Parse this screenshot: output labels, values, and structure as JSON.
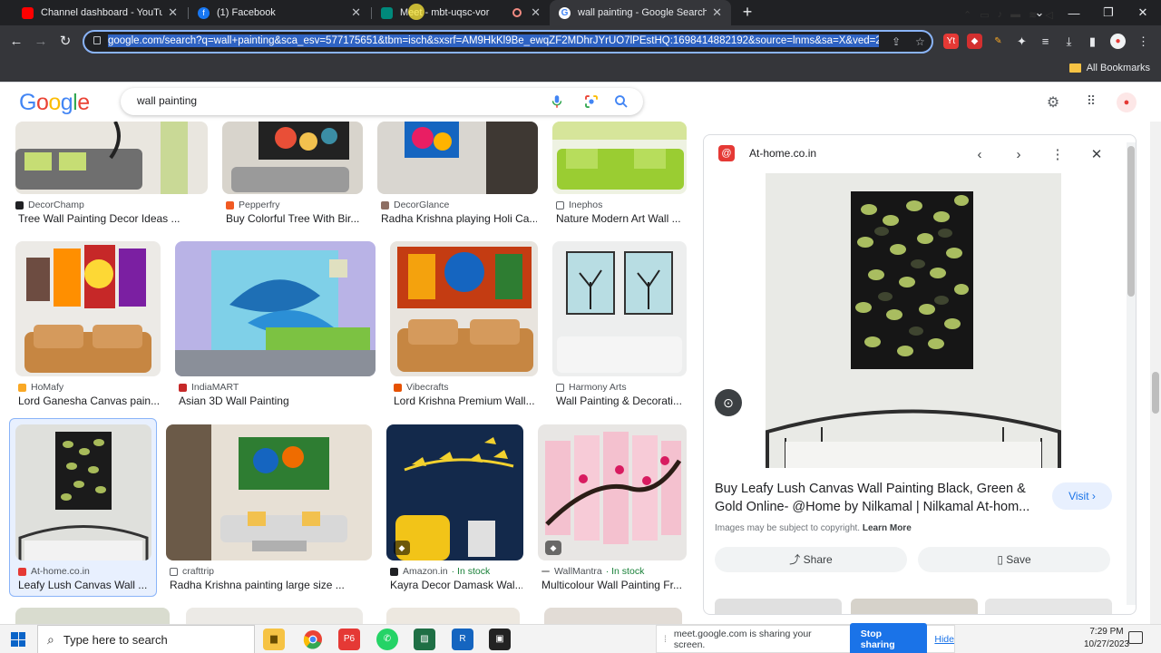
{
  "browser": {
    "tabs": [
      {
        "title": "Channel dashboard - YouTube S",
        "favicon_color": "#ff0000",
        "active": false
      },
      {
        "title": "(1) Facebook",
        "favicon_color": "#1877f2",
        "active": false
      },
      {
        "title": "Meet - mbt-uqsc-vor",
        "favicon_color": "#00897b",
        "active": false
      },
      {
        "title": "wall painting - Google Search",
        "favicon_color": "#ffffff",
        "active": true
      }
    ],
    "url": "google.com/search?q=wall+painting&sca_esv=577175651&tbm=isch&sxsrf=AM9HkKl9Be_ewqZF2MDhrJYrUO7lPEstHQ:1698414882192&source=lnms&sa=X&ved=2",
    "bookmarks_folder": "All Bookmarks"
  },
  "google": {
    "logo_letters": [
      {
        "ch": "G",
        "color": "#4285f4"
      },
      {
        "ch": "o",
        "color": "#ea4335"
      },
      {
        "ch": "o",
        "color": "#fbbc05"
      },
      {
        "ch": "g",
        "color": "#4285f4"
      },
      {
        "ch": "l",
        "color": "#34a853"
      },
      {
        "ch": "e",
        "color": "#ea4335"
      }
    ],
    "query": "wall painting"
  },
  "results": [
    {
      "source": "DecorChamp",
      "title": "Tree Wall Painting Decor Ideas ...",
      "fav": "#202124",
      "stock": ""
    },
    {
      "source": "Pepperfry",
      "title": "Buy Colorful Tree With Bir...",
      "fav": "#f15a22",
      "stock": ""
    },
    {
      "source": "DecorGlance",
      "title": "Radha Krishna playing Holi Ca...",
      "fav": "#8d6e63",
      "stock": ""
    },
    {
      "source": "Inephos",
      "title": "Nature Modern Art Wall ...",
      "fav": "#5f6368",
      "stock": ""
    },
    {
      "source": "HoMafy",
      "title": "Lord Ganesha Canvas pain...",
      "fav": "#f9a825",
      "stock": ""
    },
    {
      "source": "IndiaMART",
      "title": "Asian 3D Wall Painting",
      "fav": "#c62828",
      "stock": ""
    },
    {
      "source": "Vibecrafts",
      "title": "Lord Krishna Premium Wall...",
      "fav": "#e65100",
      "stock": ""
    },
    {
      "source": "Harmony Arts",
      "title": "Wall Painting & Decorati...",
      "fav": "#5f6368",
      "stock": ""
    },
    {
      "source": "At-home.co.in",
      "title": "Leafy Lush Canvas Wall ...",
      "fav": "#e53935",
      "stock": ""
    },
    {
      "source": "crafttrip",
      "title": "Radha Krishna painting large size ...",
      "fav": "#5f6368",
      "stock": ""
    },
    {
      "source": "Amazon.in",
      "title": "Kayra Decor Damask Wal...",
      "fav": "#202124",
      "stock": "· In stock"
    },
    {
      "source": "WallMantra",
      "title": "Multicolour Wall Painting Fr...",
      "fav": "#9e9e9e",
      "stock": "· In stock"
    }
  ],
  "panel": {
    "source": "At-home.co.in",
    "title": "Buy Leafy Lush Canvas Wall Painting Black, Green & Gold Online- @Home by Nilkamal | Nilkamal At-hom...",
    "visit": "Visit",
    "copyright": "Images may be subject to copyright.",
    "learn_more": "Learn More",
    "share": "Share",
    "save": "Save"
  },
  "sharebar": {
    "message": "meet.google.com is sharing your screen.",
    "stop": "Stop sharing",
    "hide": "Hide"
  },
  "taskbar": {
    "search_placeholder": "Type here to search",
    "time": "7:29 PM",
    "date": "10/27/2023"
  }
}
